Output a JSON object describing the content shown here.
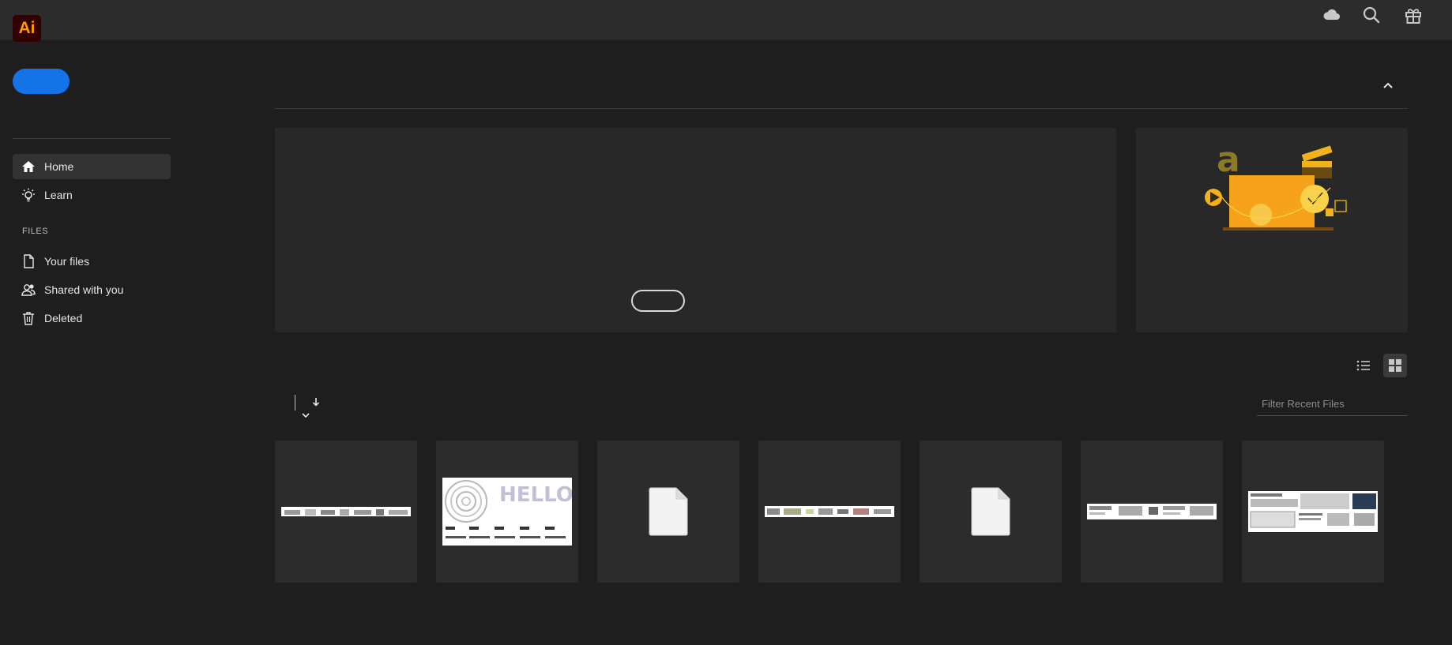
{
  "app": {
    "logo_text": "Ai",
    "brand_color": "#ff9a00",
    "accent_color": "#1473e6"
  },
  "topbar": {
    "icons": [
      "cloud-icon",
      "search-icon",
      "gift-icon"
    ]
  },
  "sidebar": {
    "create_label": "",
    "items": [
      {
        "label": "Home",
        "icon": "home-icon",
        "active": true
      },
      {
        "label": "Learn",
        "icon": "lightbulb-icon",
        "active": false
      }
    ],
    "files_section_label": "FILES",
    "file_items": [
      {
        "label": "Your files",
        "icon": "document-icon"
      },
      {
        "label": "Shared with you",
        "icon": "shared-users-icon"
      },
      {
        "label": "Deleted",
        "icon": "trash-icon"
      }
    ]
  },
  "hero": {
    "pill_label": ""
  },
  "recent": {
    "filter_placeholder": "Filter Recent Files",
    "view_modes": [
      "list-view-icon",
      "grid-view-icon"
    ],
    "active_view": "grid",
    "files": [
      {
        "thumb": "wide-strip"
      },
      {
        "thumb": "hello-fresh",
        "text": "HELLO FRESH"
      },
      {
        "thumb": "generic-document"
      },
      {
        "thumb": "wide-strip"
      },
      {
        "thumb": "generic-document"
      },
      {
        "thumb": "wide-strip"
      },
      {
        "thumb": "layout-sheet"
      }
    ]
  }
}
